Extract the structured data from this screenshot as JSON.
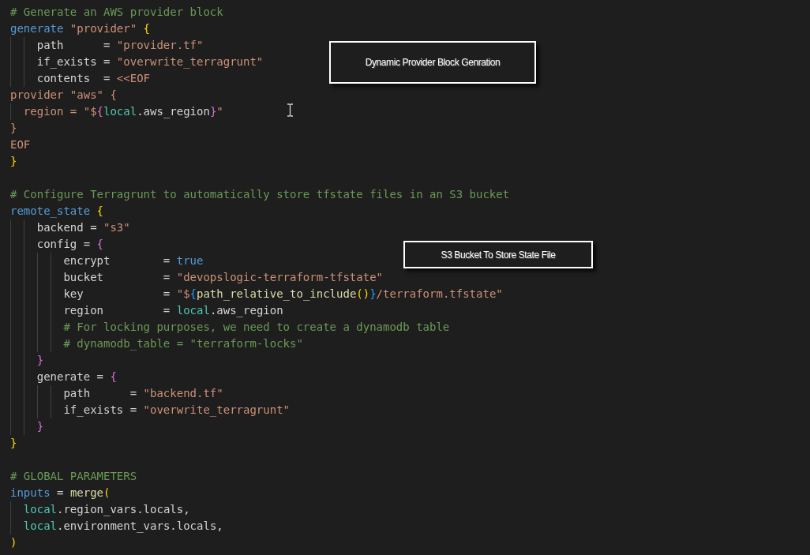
{
  "editor": {
    "lines": [
      {
        "kind": "code",
        "tokens": [
          {
            "kind": "comment",
            "text": "# Generate an AWS provider block"
          }
        ]
      },
      {
        "kind": "code",
        "tokens": [
          {
            "kind": "keyword",
            "text": "generate"
          },
          {
            "kind": "string",
            "text": " \"provider\" "
          },
          {
            "kind": "bracket1",
            "text": "{"
          }
        ]
      },
      {
        "kind": "code",
        "tokens": [
          {
            "kind": "plain",
            "text": "    path      = "
          },
          {
            "kind": "string",
            "text": "\"provider.tf\""
          }
        ]
      },
      {
        "kind": "code",
        "tokens": [
          {
            "kind": "plain",
            "text": "    if_exists = "
          },
          {
            "kind": "string",
            "text": "\"overwrite_terragrunt\""
          }
        ]
      },
      {
        "kind": "code",
        "tokens": [
          {
            "kind": "plain",
            "text": "    contents  = "
          },
          {
            "kind": "string",
            "text": "<<EOF"
          }
        ]
      },
      {
        "kind": "code",
        "tokens": [
          {
            "kind": "string",
            "text": "provider \"aws\" {"
          }
        ]
      },
      {
        "kind": "code",
        "tokens": [
          {
            "kind": "string",
            "text": "  region = \"$"
          },
          {
            "kind": "bracket2",
            "text": "{"
          },
          {
            "kind": "type",
            "text": "local"
          },
          {
            "kind": "plain",
            "text": ".aws_region"
          },
          {
            "kind": "bracket2",
            "text": "}"
          },
          {
            "kind": "string",
            "text": "\""
          }
        ]
      },
      {
        "kind": "code",
        "tokens": [
          {
            "kind": "string",
            "text": "}"
          }
        ]
      },
      {
        "kind": "code",
        "tokens": [
          {
            "kind": "string",
            "text": "EOF"
          }
        ]
      },
      {
        "kind": "code",
        "tokens": [
          {
            "kind": "bracket1",
            "text": "}"
          }
        ]
      },
      {
        "kind": "blank"
      },
      {
        "kind": "code",
        "tokens": [
          {
            "kind": "comment",
            "text": "# Configure Terragrunt to automatically store tfstate files in an S3 bucket"
          }
        ]
      },
      {
        "kind": "code",
        "tokens": [
          {
            "kind": "keyword",
            "text": "remote_state"
          },
          {
            "kind": "bracket1",
            "text": " {"
          }
        ]
      },
      {
        "kind": "code",
        "tokens": [
          {
            "kind": "plain",
            "text": "    backend = "
          },
          {
            "kind": "string",
            "text": "\"s3\""
          }
        ]
      },
      {
        "kind": "code",
        "tokens": [
          {
            "kind": "plain",
            "text": "    config = "
          },
          {
            "kind": "bracket2",
            "text": "{"
          }
        ]
      },
      {
        "kind": "code",
        "tokens": [
          {
            "kind": "plain",
            "text": "        encrypt        = "
          },
          {
            "kind": "keyword",
            "text": "true"
          }
        ]
      },
      {
        "kind": "code",
        "tokens": [
          {
            "kind": "plain",
            "text": "        bucket         = "
          },
          {
            "kind": "string",
            "text": "\"devopslogic-terraform-tfstate\""
          }
        ]
      },
      {
        "kind": "code",
        "tokens": [
          {
            "kind": "plain",
            "text": "        key            = "
          },
          {
            "kind": "string",
            "text": "\"$"
          },
          {
            "kind": "bracket3",
            "text": "{"
          },
          {
            "kind": "function",
            "text": "path_relative_to_include"
          },
          {
            "kind": "bracket1",
            "text": "()"
          },
          {
            "kind": "bracket3",
            "text": "}"
          },
          {
            "kind": "string",
            "text": "/terraform.tfstate\""
          }
        ]
      },
      {
        "kind": "code",
        "tokens": [
          {
            "kind": "plain",
            "text": "        region         = "
          },
          {
            "kind": "type",
            "text": "local"
          },
          {
            "kind": "plain",
            "text": ".aws_region"
          }
        ]
      },
      {
        "kind": "code",
        "tokens": [
          {
            "kind": "comment",
            "text": "        # For locking purposes, we need to create a dynamodb table"
          }
        ]
      },
      {
        "kind": "code",
        "tokens": [
          {
            "kind": "comment",
            "text": "        # dynamodb_table = \"terraform-locks\""
          }
        ]
      },
      {
        "kind": "code",
        "tokens": [
          {
            "kind": "bracket2",
            "text": "    }"
          }
        ]
      },
      {
        "kind": "code",
        "tokens": [
          {
            "kind": "plain",
            "text": "    generate = "
          },
          {
            "kind": "bracket2",
            "text": "{"
          }
        ]
      },
      {
        "kind": "code",
        "tokens": [
          {
            "kind": "plain",
            "text": "        path      = "
          },
          {
            "kind": "string",
            "text": "\"backend.tf\""
          }
        ]
      },
      {
        "kind": "code",
        "tokens": [
          {
            "kind": "plain",
            "text": "        if_exists = "
          },
          {
            "kind": "string",
            "text": "\"overwrite_terragrunt\""
          }
        ]
      },
      {
        "kind": "code",
        "tokens": [
          {
            "kind": "bracket2",
            "text": "    }"
          }
        ]
      },
      {
        "kind": "code",
        "tokens": [
          {
            "kind": "bracket1",
            "text": "}"
          }
        ]
      },
      {
        "kind": "blank"
      },
      {
        "kind": "code",
        "tokens": [
          {
            "kind": "comment",
            "text": "# GLOBAL PARAMETERS"
          }
        ]
      },
      {
        "kind": "code",
        "tokens": [
          {
            "kind": "keyword",
            "text": "inputs"
          },
          {
            "kind": "plain",
            "text": " = "
          },
          {
            "kind": "function",
            "text": "merge"
          },
          {
            "kind": "bracket1",
            "text": "("
          }
        ]
      },
      {
        "kind": "code",
        "tokens": [
          {
            "kind": "type",
            "text": "  local"
          },
          {
            "kind": "plain",
            "text": ".region_vars.locals,"
          }
        ]
      },
      {
        "kind": "code",
        "tokens": [
          {
            "kind": "type",
            "text": "  local"
          },
          {
            "kind": "plain",
            "text": ".environment_vars.locals,"
          }
        ]
      },
      {
        "kind": "code",
        "tokens": [
          {
            "kind": "bracket1",
            "text": ")"
          }
        ]
      }
    ]
  },
  "callouts": [
    {
      "text": "Dynamic Provider Block Genration"
    },
    {
      "text": "S3 Bucket To Store State File"
    }
  ]
}
